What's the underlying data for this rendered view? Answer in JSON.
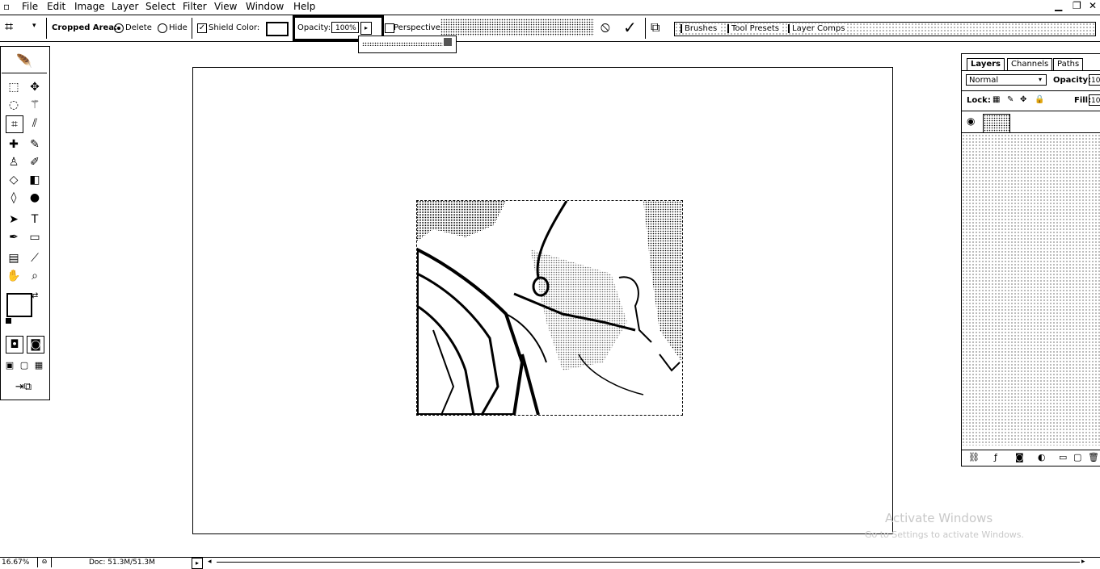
{
  "menu": [
    "File",
    "Edit",
    "Image",
    "Layer",
    "Select",
    "Filter",
    "View",
    "Window",
    "Help"
  ],
  "options": {
    "cropped_area_label": "Cropped Area:",
    "delete_label": "Delete",
    "hide_label": "Hide",
    "shield_label": "Shield",
    "color_label": "Color:",
    "opacity_label": "Opacity:",
    "opacity_value": "100%",
    "perspective_label": "Perspective",
    "cancel_symbol": "⦸",
    "commit_symbol": "✓",
    "palette_tabs": [
      "Brushes",
      "Tool Presets",
      "Layer Comps"
    ]
  },
  "layers_panel": {
    "tabs": [
      "Layers",
      "Channels",
      "Paths"
    ],
    "blend_mode": "Normal",
    "opacity_label": "Opacity:",
    "opacity_value": "10",
    "lock_label": "Lock:",
    "fill_label": "Fill:",
    "fill_value": "10"
  },
  "status": {
    "zoom": "16.67%",
    "doc_info": "Doc: 51.3M/51.3M"
  },
  "watermark": {
    "line1": "Activate Windows",
    "line2": "Go to Settings to activate Windows."
  },
  "icons": {
    "crop": "crop-icon",
    "minimize": "minimize-icon",
    "restore": "restore-icon",
    "close": "close-icon"
  }
}
